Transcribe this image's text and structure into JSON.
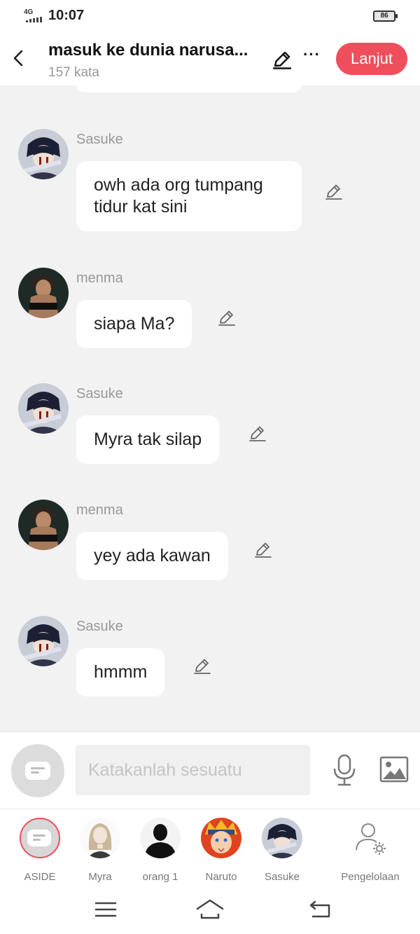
{
  "status_bar": {
    "network": "4G",
    "time": "10:07",
    "battery": "86"
  },
  "header": {
    "title": "masuk ke dunia narusa...",
    "word_count": "157 kata",
    "next_label": "Lanjut",
    "more_label": "···"
  },
  "messages": [
    {
      "speaker": "Sasuke",
      "text": "owh ada org tumpang tidur kat sini",
      "avatar": "sasuke"
    },
    {
      "speaker": "menma",
      "text": "siapa Ma?",
      "avatar": "menma"
    },
    {
      "speaker": "Sasuke",
      "text": "Myra tak silap",
      "avatar": "sasuke"
    },
    {
      "speaker": "menma",
      "text": "yey ada kawan",
      "avatar": "menma"
    },
    {
      "speaker": "Sasuke",
      "text": "hmmm",
      "avatar": "sasuke"
    }
  ],
  "composer": {
    "placeholder": "Katakanlah sesuatu"
  },
  "characters": [
    {
      "label": "ASIDE"
    },
    {
      "label": "Myra"
    },
    {
      "label": "orang 1"
    },
    {
      "label": "Naruto"
    },
    {
      "label": "Sasuke"
    },
    {
      "label": "Pengelolaan"
    }
  ],
  "colors": {
    "accent": "#ef4f5d",
    "background": "#f2f2f2",
    "bubble": "#ffffff",
    "muted_text": "#999999"
  },
  "icons": [
    "back-icon",
    "pencil-icon",
    "more-icon",
    "mic-icon",
    "image-icon",
    "settings-user-icon",
    "menu-icon",
    "home-icon",
    "back-nav-icon"
  ]
}
